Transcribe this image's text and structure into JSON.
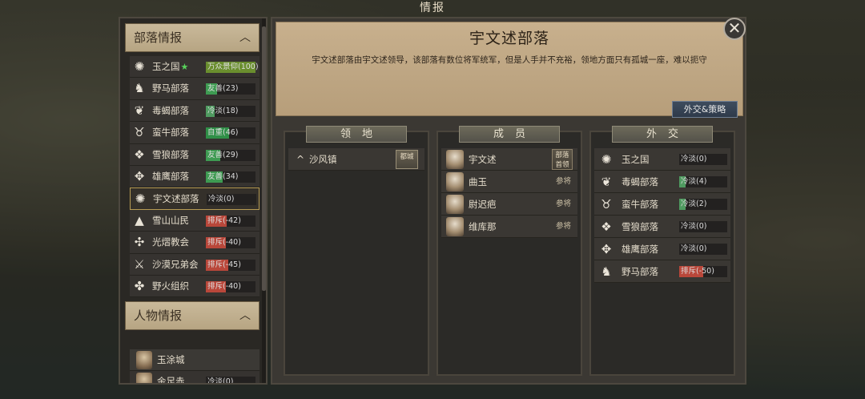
{
  "window_title": "情报",
  "left_panel": {
    "tribe_section": {
      "title": "部落情报"
    },
    "tribes": [
      {
        "name": "玉之国",
        "star": "★",
        "relation": "万众景仰(100)",
        "color": "#6a8e2e",
        "fill": 1.0,
        "icon": "crest-icon"
      },
      {
        "name": "野马部落",
        "relation": "友善(23)",
        "color": "#3e9b52",
        "fill": 0.23,
        "icon": "horse-icon"
      },
      {
        "name": "毒蝎部落",
        "relation": "冷淡(18)",
        "color": "#4f9a60",
        "fill": 0.18,
        "icon": "scorpion-icon"
      },
      {
        "name": "蛮牛部落",
        "relation": "自重(46)",
        "color": "#2f8f47",
        "fill": 0.46,
        "icon": "bull-icon"
      },
      {
        "name": "雪狼部落",
        "relation": "友善(29)",
        "color": "#3e9b52",
        "fill": 0.29,
        "icon": "wolf-icon"
      },
      {
        "name": "雄鹰部落",
        "relation": "友善(34)",
        "color": "#3e9b52",
        "fill": 0.34,
        "icon": "eagle-icon"
      },
      {
        "name": "宇文述部落",
        "relation": "冷淡(0)",
        "color": "#5a5a5a",
        "fill": 0.0,
        "icon": "crest-icon",
        "selected": true
      },
      {
        "name": "雪山山民",
        "relation": "排斥(-42)",
        "color": "#b9473a",
        "fill": 0.42,
        "icon": "mountain-icon"
      },
      {
        "name": "光熠教会",
        "relation": "排斥(-40)",
        "color": "#b9473a",
        "fill": 0.4,
        "icon": "church-icon"
      },
      {
        "name": "沙漠兄弟会",
        "relation": "排斥(-45)",
        "color": "#b9473a",
        "fill": 0.45,
        "icon": "swords-icon"
      },
      {
        "name": "野火组织",
        "relation": "排斥(-40)",
        "color": "#b9473a",
        "fill": 0.4,
        "icon": "fire-icon"
      }
    ],
    "character_section": {
      "title": "人物情报"
    },
    "characters": [
      {
        "name": "玉涂城",
        "relation": ""
      },
      {
        "name": "金足赤",
        "relation": "冷淡(0)"
      }
    ]
  },
  "detail": {
    "title": "宇文述部落",
    "description": "宇文述部落由宇文述领导，该部落有数位将军统军，但是人手并不充裕，领地方面只有孤城一座，难以扼守",
    "diplomacy_button": "外交&策略",
    "close_label": "✕"
  },
  "columns": {
    "territory": {
      "header": "领地",
      "items": [
        {
          "caret": "^",
          "name": "沙风镇",
          "badge": "都城"
        }
      ]
    },
    "members": {
      "header": "成员",
      "items": [
        {
          "name": "宇文述",
          "role_badge": "部落首领"
        },
        {
          "name": "曲玉",
          "role": "参将"
        },
        {
          "name": "尉迟疤",
          "role": "参将"
        },
        {
          "name": "维库那",
          "role": "参将"
        }
      ]
    },
    "diplomacy": {
      "header": "外交",
      "items": [
        {
          "name": "玉之国",
          "relation": "冷淡(0)",
          "color": "#5a5a5a",
          "fill": 0.0,
          "icon": "crest-icon"
        },
        {
          "name": "毒蝎部落",
          "relation": "冷淡(4)",
          "color": "#4f9a60",
          "fill": 0.04,
          "icon": "scorpion-icon"
        },
        {
          "name": "蛮牛部落",
          "relation": "冷淡(2)",
          "color": "#4f9a60",
          "fill": 0.02,
          "icon": "bull-icon"
        },
        {
          "name": "雪狼部落",
          "relation": "冷淡(0)",
          "color": "#5a5a5a",
          "fill": 0.0,
          "icon": "wolf-icon"
        },
        {
          "name": "雄鹰部落",
          "relation": "冷淡(0)",
          "color": "#5a5a5a",
          "fill": 0.0,
          "icon": "eagle-icon"
        },
        {
          "name": "野马部落",
          "relation": "排斥(-50)",
          "color": "#b9473a",
          "fill": 0.5,
          "icon": "horse-icon"
        }
      ]
    }
  }
}
